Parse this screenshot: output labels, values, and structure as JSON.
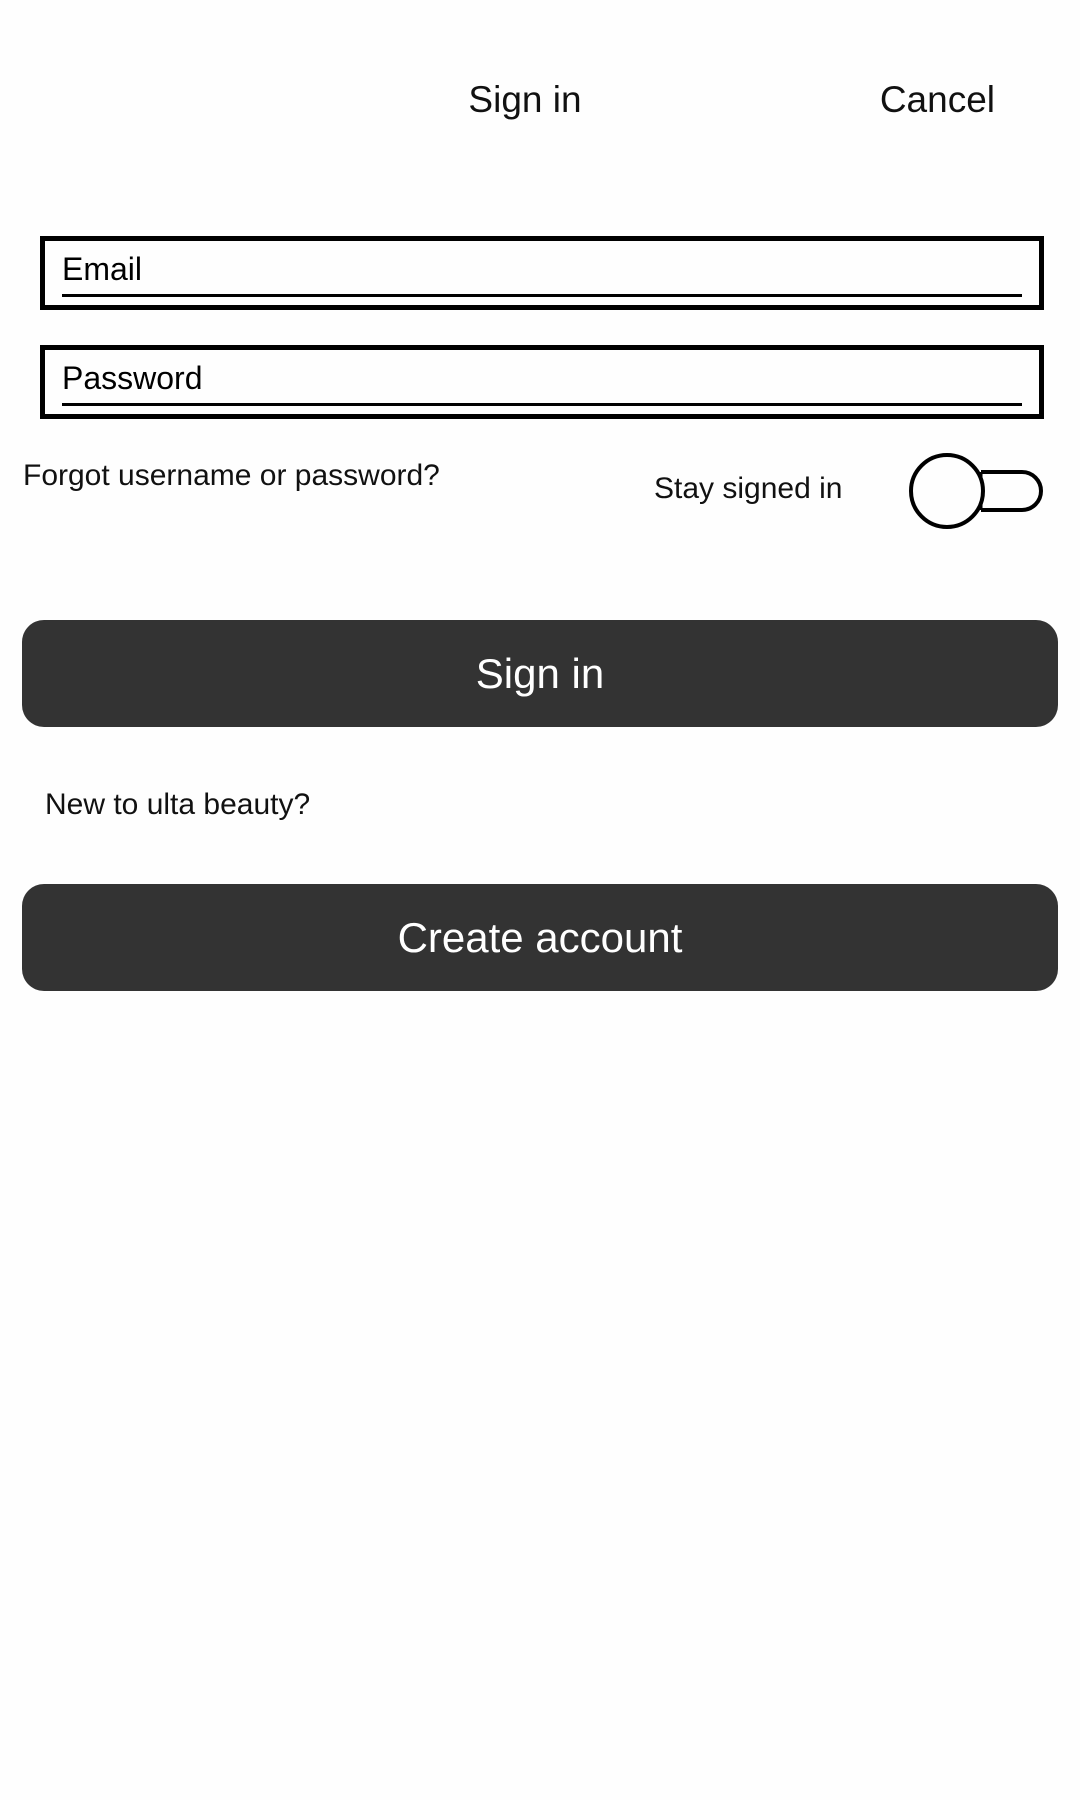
{
  "header": {
    "title": "Sign in",
    "cancel_label": "Cancel"
  },
  "form": {
    "email": {
      "placeholder": "Email",
      "value": ""
    },
    "password": {
      "placeholder": "Password",
      "value": ""
    },
    "forgot_label": "Forgot username or password?",
    "stay_signed_in_label": "Stay signed in",
    "stay_signed_in_on": false,
    "sign_in_label": "Sign in"
  },
  "signup": {
    "prompt": "New to ulta beauty?",
    "create_label": "Create account"
  },
  "colors": {
    "button_bg": "#333333",
    "button_text": "#ffffff",
    "text": "#111111",
    "background": "#fefefe"
  }
}
